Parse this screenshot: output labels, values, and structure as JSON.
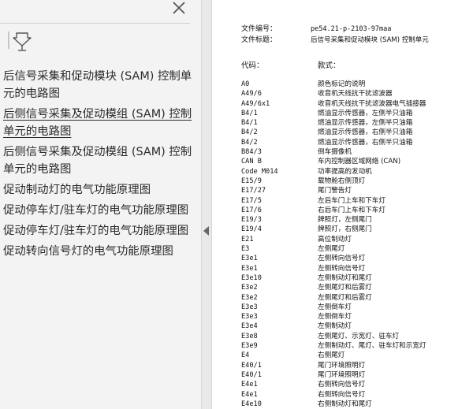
{
  "sidebar": {
    "bookmarks": [
      {
        "label": "后信号采集和促动模块 (SAM) 控制单元的电路图",
        "selected": false
      },
      {
        "label": "后侧信号采集及促动模组 (SAM) 控制单元的电路图",
        "selected": true
      },
      {
        "label": "后侧信号采集及促动模组 (SAM) 控制单元的电路图",
        "selected": false
      },
      {
        "label": "促动制动灯的电气功能原理图",
        "selected": false
      },
      {
        "label": "促动停车灯/驻车灯的电气功能原理图",
        "selected": false
      },
      {
        "label": "促动停车灯/驻车灯的电气功能原理图",
        "selected": false
      },
      {
        "label": "促动转向信号灯的电气功能原理图",
        "selected": false
      }
    ]
  },
  "document": {
    "file_number_label": "文件编号：",
    "file_number": "pe54.21-p-2103-97maa",
    "file_title_label": "文件标题：",
    "file_title": "后信号采集和促动模块 (SAM) 控制单元",
    "code_header": "代码：",
    "desc_header": "款式：",
    "rows": [
      {
        "code": "A0",
        "desc": "颜色标记的说明"
      },
      {
        "code": "A49/6",
        "desc": "收音机天线抗干扰滤波器"
      },
      {
        "code": "A49/6x1",
        "desc": "收音机天线抗干扰滤波器电气插接器"
      },
      {
        "code": "B4/1",
        "desc": "燃油显示传感器，左侧半只油箱"
      },
      {
        "code": "B4/1",
        "desc": "燃油显示传感器，左侧半只油箱"
      },
      {
        "code": "B4/2",
        "desc": "燃油显示传感器，右侧半只油箱"
      },
      {
        "code": "B4/2",
        "desc": "燃油显示传感器，右侧半只油箱"
      },
      {
        "code": "B84/3",
        "desc": "倒车摄像机"
      },
      {
        "code": "CAN B",
        "desc": "车内控制器区域网络 (CAN)"
      },
      {
        "code": "Code M014",
        "desc": "功率提高的发动机"
      },
      {
        "code": "E15/9",
        "desc": "载物舱右侧顶灯"
      },
      {
        "code": "E17/27",
        "desc": "尾门警告灯"
      },
      {
        "code": "E17/5",
        "desc": "左后车门上车和下车灯"
      },
      {
        "code": "E17/6",
        "desc": "右后车门上车和下车灯"
      },
      {
        "code": "E19/3",
        "desc": "牌照灯，左侧尾门"
      },
      {
        "code": "E19/4",
        "desc": "牌照灯，右侧尾门"
      },
      {
        "code": "E21",
        "desc": "高位制动灯"
      },
      {
        "code": "E3",
        "desc": "左侧尾灯"
      },
      {
        "code": "E3e1",
        "desc": "左侧转向信号灯"
      },
      {
        "code": "E3e1",
        "desc": "左侧转向信号灯"
      },
      {
        "code": "E3e10",
        "desc": "左侧制动灯和尾灯"
      },
      {
        "code": "E3e2",
        "desc": "左侧尾灯和后雾灯"
      },
      {
        "code": "E3e2",
        "desc": "左侧尾灯和后雾灯"
      },
      {
        "code": "E3e3",
        "desc": "左侧倒车灯"
      },
      {
        "code": "E3e3",
        "desc": "左侧倒车灯"
      },
      {
        "code": "E3e4",
        "desc": "左侧制动灯"
      },
      {
        "code": "E3e8",
        "desc": "左侧尾灯、示宽灯、驻车灯"
      },
      {
        "code": "E3e9",
        "desc": "左侧制动灯、尾灯、驻车灯和示宽灯"
      },
      {
        "code": "E4",
        "desc": "右侧尾灯"
      },
      {
        "code": "E40/1",
        "desc": "尾门环境照明灯"
      },
      {
        "code": "E40/1",
        "desc": "尾门环境照明灯"
      },
      {
        "code": "E4e1",
        "desc": "右侧转向信号灯"
      },
      {
        "code": "E4e1",
        "desc": "右侧转向信号灯"
      },
      {
        "code": "E4e10",
        "desc": "右侧制动灯和尾灯"
      }
    ]
  },
  "icons": {
    "close": "close-icon",
    "bookmark_tool": "bookmark-options-icon",
    "collapse": "collapse-panel-icon"
  }
}
